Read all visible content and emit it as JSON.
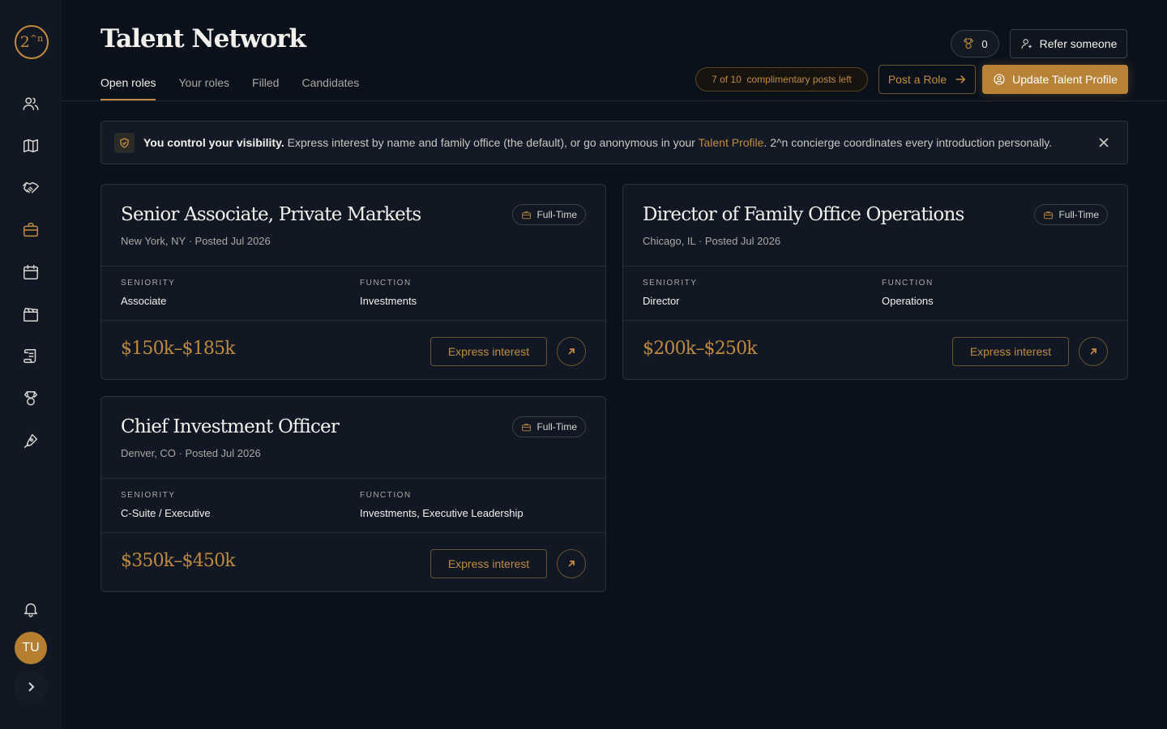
{
  "app": {
    "logo": "2",
    "logo_sup": "^n",
    "title": "Talent Network",
    "avatar_initials": "TU"
  },
  "tabs": [
    {
      "label": "Open roles",
      "active": true
    },
    {
      "label": "Your roles",
      "active": false
    },
    {
      "label": "Filled",
      "active": false
    },
    {
      "label": "Candidates",
      "active": false
    }
  ],
  "header": {
    "award_count": "0",
    "refer_label": "Refer someone",
    "posts_left": "7 of 10  complimentary posts left",
    "post_role_label": "Post a Role",
    "update_profile_label": "Update Talent Profile"
  },
  "banner": {
    "bold": "You control your visibility.",
    "text_before_link": " Express interest by name and family office (the default), or go anonymous in your ",
    "link": "Talent Profile",
    "text_after_link": ". 2^n concierge coordinates every introduction personally."
  },
  "labels": {
    "seniority": "SENIORITY",
    "function": "FUNCTION",
    "express": "Express interest"
  },
  "roles": [
    {
      "title": "Senior Associate, Private Markets",
      "subtitle": "New York, NY · Posted Jul 2026",
      "type": "Full-Time",
      "seniority": "Associate",
      "function": "Investments",
      "salary": "$150k–$185k"
    },
    {
      "title": "Director of Family Office Operations",
      "subtitle": "Chicago, IL · Posted Jul 2026",
      "type": "Full-Time",
      "seniority": "Director",
      "function": "Operations",
      "salary": "$200k–$250k"
    },
    {
      "title": "Chief Investment Officer",
      "subtitle": "Denver, CO · Posted Jul 2026",
      "type": "Full-Time",
      "seniority": "C-Suite / Executive",
      "function": "Investments, Executive Leadership",
      "salary": "$350k–$450k"
    }
  ],
  "colors": {
    "accent": "#c08a3e",
    "background": "#0b111b",
    "sidebar": "#111823"
  },
  "icons": {
    "sidebar": [
      "people-icon",
      "map-icon",
      "handshake-icon",
      "briefcase-icon",
      "calendar-icon",
      "film-icon",
      "scroll-icon",
      "trophy-icon",
      "pen-icon"
    ],
    "bottom": [
      "bell-icon",
      "chevron-right-icon"
    ]
  }
}
